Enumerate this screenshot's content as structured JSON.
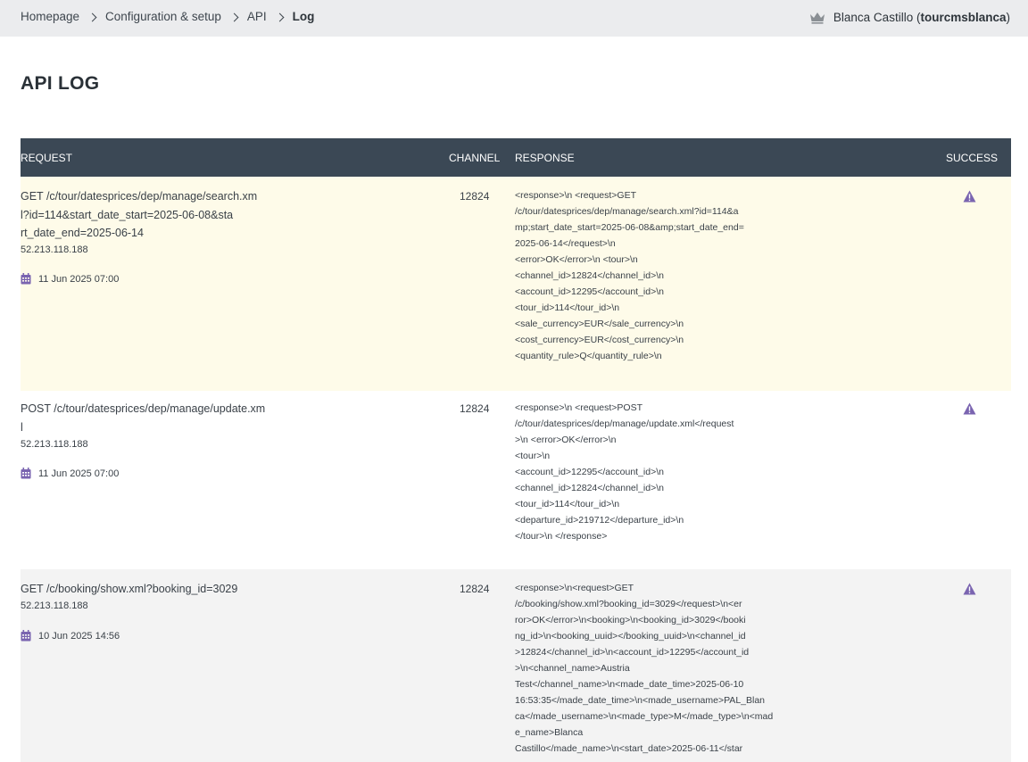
{
  "breadcrumb": {
    "items": [
      "Homepage",
      "Configuration & setup",
      "API"
    ],
    "current": "Log"
  },
  "user": {
    "name": "Blanca Castillo",
    "open_paren": "(",
    "username": "tourcmsblanca",
    "close_paren": ")",
    "icon": "crown-icon"
  },
  "page": {
    "title": "API LOG"
  },
  "table": {
    "headers": {
      "request": "REQUEST",
      "channel": "CHANNEL",
      "response": "RESPONSE",
      "success": "SUCCESS"
    },
    "rows": [
      {
        "request": [
          "GET /c/tour/datesprices/dep/manage/search.xm",
          "l?id=114&start_date_start=2025-06-08&sta",
          "rt_date_end=2025-06-14"
        ],
        "ip": "52.213.118.188",
        "date": "11 Jun 2025 07:00",
        "channel": "12824",
        "response": [
          "<response>\\n <request>GET",
          "/c/tour/datesprices/dep/manage/search.xml?id=114&a",
          "mp;start_date_start=2025-06-08&amp;start_date_end=",
          "2025-06-14</request>\\n",
          "<error>OK</error>\\n <tour>\\n",
          "<channel_id>12824</channel_id>\\n",
          "<account_id>12295</account_id>\\n",
          "<tour_id>114</tour_id>\\n",
          "<sale_currency>EUR</sale_currency>\\n",
          "<cost_currency>EUR</cost_currency>\\n",
          "<quantity_rule>Q</quantity_rule>\\n"
        ],
        "status_icon": "warning-icon"
      },
      {
        "request": [
          "POST /c/tour/datesprices/dep/manage/update.xm",
          "l"
        ],
        "ip": "52.213.118.188",
        "date": "11 Jun 2025 07:00",
        "channel": "12824",
        "response": [
          "<response>\\n <request>POST",
          "/c/tour/datesprices/dep/manage/update.xml</request",
          ">\\n <error>OK</error>\\n",
          "<tour>\\n",
          "<account_id>12295</account_id>\\n",
          "<channel_id>12824</channel_id>\\n",
          "<tour_id>114</tour_id>\\n",
          "<departure_id>219712</departure_id>\\n",
          "</tour>\\n </response>"
        ],
        "status_icon": "warning-icon"
      },
      {
        "request": [
          "GET /c/booking/show.xml?booking_id=3029"
        ],
        "ip": "52.213.118.188",
        "date": "10 Jun 2025 14:56",
        "channel": "12824",
        "response": [
          "<response>\\n<request>GET",
          "/c/booking/show.xml?booking_id=3029</request>\\n<er",
          "ror>OK</error>\\n<booking>\\n<booking_id>3029</booki",
          "ng_id>\\n<booking_uuid></booking_uuid>\\n<channel_id",
          ">12824</channel_id>\\n<account_id>12295</account_id",
          ">\\n<channel_name>Austria",
          "Test</channel_name>\\n<made_date_time>2025-06-10",
          "16:53:35</made_date_time>\\n<made_username>PAL_Blan",
          "ca</made_username>\\n<made_type>M</made_type>\\n<mad",
          "e_name>Blanca",
          "Castillo</made_name>\\n<start_date>2025-06-11</star"
        ],
        "status_icon": "warning-icon"
      }
    ]
  }
}
